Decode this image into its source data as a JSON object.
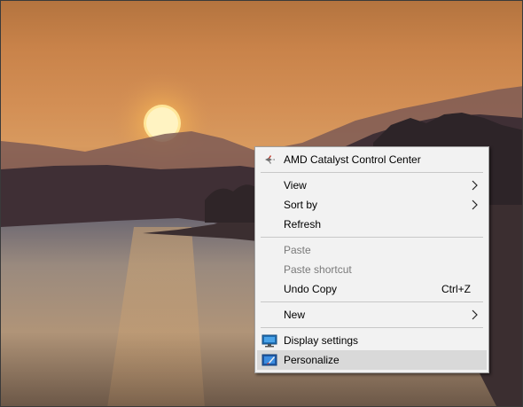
{
  "desktop": {
    "wallpaper": "sunset over lake"
  },
  "context_menu": {
    "amd_catalyst": "AMD Catalyst Control Center",
    "view": "View",
    "sort_by": "Sort by",
    "refresh": "Refresh",
    "paste": "Paste",
    "paste_shortcut": "Paste shortcut",
    "undo_copy": "Undo Copy",
    "undo_copy_shortcut": "Ctrl+Z",
    "new": "New",
    "display_settings": "Display settings",
    "personalize": "Personalize",
    "highlighted_item": "Personalize",
    "icons": {
      "amd_catalyst": "amd-catalyst-icon",
      "display_settings": "monitor-icon",
      "personalize": "personalize-icon",
      "submenu": "chevron-right-icon"
    }
  }
}
